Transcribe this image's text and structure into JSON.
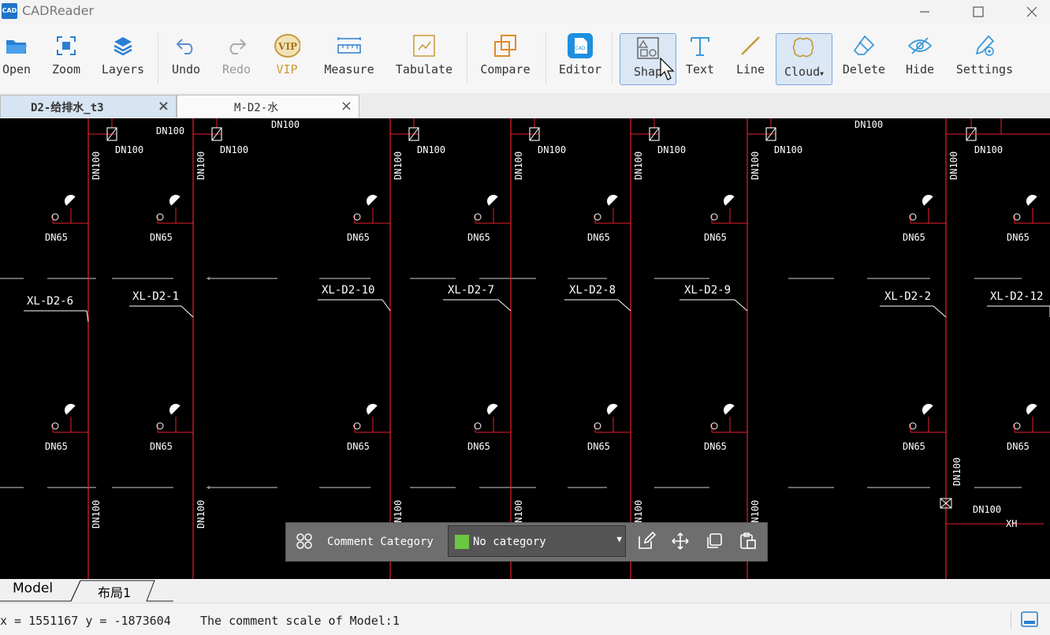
{
  "app": {
    "title": "CADReader",
    "icon_text": "CAD"
  },
  "toolbar": {
    "open": "Open",
    "zoom": "Zoom",
    "layers": "Layers",
    "undo": "Undo",
    "redo": "Redo",
    "vip": "VIP",
    "measure": "Measure",
    "tabulate": "Tabulate",
    "compare": "Compare",
    "editor": "Editor",
    "shape": "Shap",
    "text": "Text",
    "line": "Line",
    "cloud": "Cloud",
    "delete": "Delete",
    "hide": "Hide",
    "settings": "Settings"
  },
  "tabs": [
    {
      "label": "D2-给排水_t3",
      "active": true
    },
    {
      "label": "M-D2-水",
      "active": false
    }
  ],
  "drawing": {
    "pipe_label_dn100": "DN100",
    "pipe_label_dn65": "DN65",
    "riser_labels": [
      "XL-D2-6",
      "XL-D2-1",
      "XL-D2-10",
      "XL-D2-7",
      "XL-D2-8",
      "XL-D2-9",
      "XL-D2-2",
      "XL-D2-12"
    ],
    "xh_label": "XH",
    "line_color": "#e8202a",
    "text_color": "#ffffff"
  },
  "comment_toolbar": {
    "category_label": "Comment Category",
    "category_value": "No category",
    "category_color": "#6bc641"
  },
  "layout_tabs": {
    "model": "Model",
    "layout1": "布局1"
  },
  "status": {
    "coords": "x = 1551167 y = -1873604",
    "scale": "The comment scale of Model:1"
  }
}
